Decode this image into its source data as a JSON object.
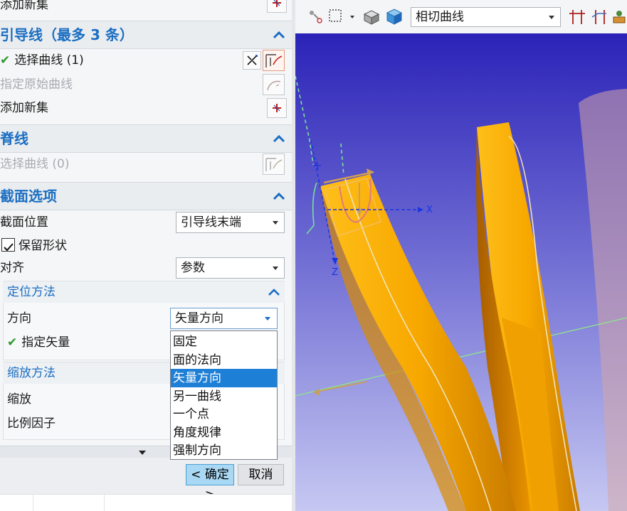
{
  "top_fragment": {
    "label": "添加新集"
  },
  "guide_section": {
    "title": "引导线（最多 3 条）",
    "select_curve": "选择曲线 (1)",
    "specify_original": "指定原始曲线",
    "add_new_set": "添加新集"
  },
  "spine_section": {
    "title": "脊线",
    "select_curve": "选择曲线 (0)"
  },
  "section_options": {
    "title": "截面选项",
    "position_label": "截面位置",
    "position_value": "引导线末端",
    "preserve_shape": "保留形状",
    "align_label": "对齐",
    "align_value": "参数"
  },
  "orientation": {
    "title": "定位方法",
    "direction_label": "方向",
    "direction_value": "矢量方向",
    "specify_vector": "指定矢量",
    "options": [
      "固定",
      "面的法向",
      "矢量方向",
      "另一曲线",
      "一个点",
      "角度规律",
      "强制方向"
    ],
    "selected_index": 2
  },
  "scaling": {
    "title": "缩放方法",
    "scale_label": "缩放",
    "factor_label": "比例因子"
  },
  "footer": {
    "ok": "< 确定 >",
    "cancel": "取消"
  },
  "toolbar": {
    "curve_rule": "相切曲线"
  },
  "viewport": {
    "axis_x": "X",
    "axis_z": "Z"
  },
  "colors": {
    "accent": "#1b6ec2",
    "viewport_top": "#2b23b8",
    "viewport_bottom": "#c6c8f2",
    "ribbon": "#f5a300",
    "selected": "#1e7fd6"
  }
}
